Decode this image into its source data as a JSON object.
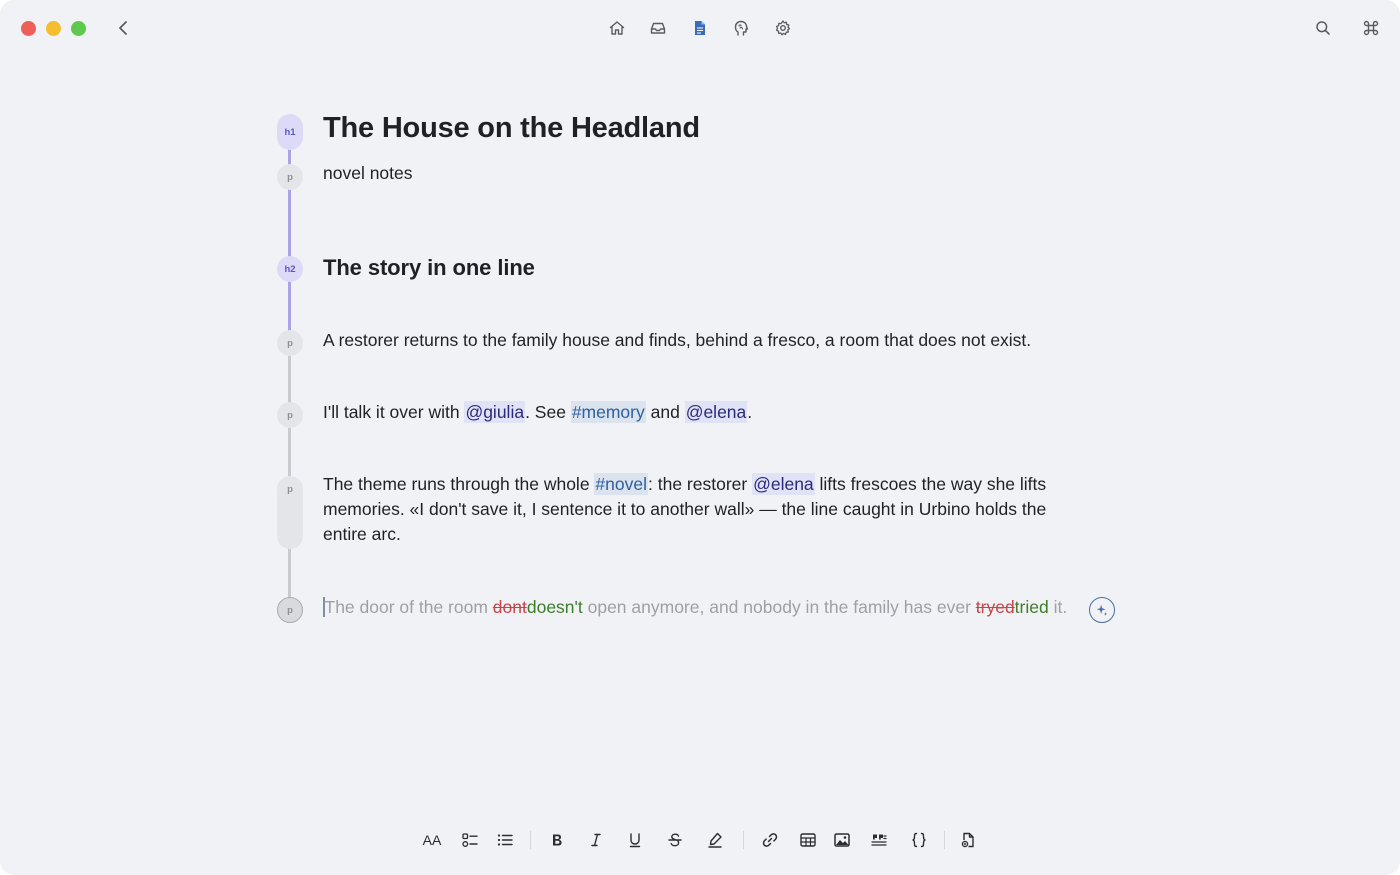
{
  "window": {
    "controls": [
      "close",
      "minimize",
      "maximize"
    ]
  },
  "toolbar_top": {
    "left": [
      "back-chevron-icon"
    ],
    "center": [
      "home-icon",
      "inbox-icon",
      "document-icon",
      "brain-icon",
      "gear-icon"
    ],
    "active": "document-icon",
    "right": [
      "search-icon",
      "command-icon"
    ],
    "accent_color": "#3b6cb6"
  },
  "document": {
    "title": "The House on the Headland",
    "subtitle": "novel notes",
    "heading2": "The story in one line",
    "blocks": [
      {
        "type": "h1"
      },
      {
        "type": "p"
      },
      {
        "type": "h2"
      },
      {
        "type": "p"
      },
      {
        "type": "p"
      },
      {
        "type": "p"
      },
      {
        "type": "p"
      }
    ],
    "badges": {
      "h1": "h1",
      "h2": "h2",
      "p": "p"
    },
    "para1": "A restorer returns to the family house and finds, behind a fresco, a room that does not exist.",
    "para2": {
      "pre": "I'll talk it over with ",
      "mention1": "@giulia",
      "mid1": ". See ",
      "tag1": "#memory",
      "mid2": " and ",
      "mention2": "@elena",
      "post": "."
    },
    "para3": {
      "pre": "The theme runs through the whole ",
      "tag": "#novel",
      "mid": ": the restorer ",
      "mention": "@elena",
      "post": " lifts frescoes the way she lifts memories. «I don't save it, I sentence it to another wall» — the line caught in Urbino holds the entire arc."
    },
    "draft": {
      "t1": "The door of the room ",
      "del1": "dont",
      "ins1": "doesn't",
      "t2": " open anymore, and nobody in the family has ever ",
      "del2": "tryed",
      "ins2": "tried",
      "t3": " it."
    },
    "colors": {
      "mention_bg": "#e0e2f5",
      "tag_bg": "#dbe3ee",
      "deleted": "#c6474a",
      "inserted": "#3d7d2c",
      "draft_text": "#9ea0a5"
    }
  },
  "format_toolbar": {
    "text_size_label": "AA",
    "items": [
      "text-size-icon",
      "checklist-icon",
      "bullet-list-icon",
      "bold-icon",
      "italic-icon",
      "underline-icon",
      "strikethrough-icon",
      "highlight-icon",
      "link-icon",
      "table-icon",
      "image-icon",
      "quote-icon",
      "code-braces-icon",
      "attachment-icon"
    ]
  }
}
